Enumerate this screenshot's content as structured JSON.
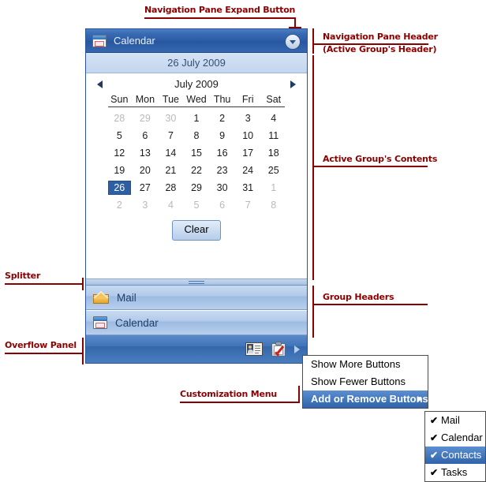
{
  "annotations": [
    {
      "key": "nav_expand",
      "text": "Navigation Pane Expand Button"
    },
    {
      "key": "nav_header",
      "text": "Navigation Pane Header"
    },
    {
      "key": "nav_header2",
      "text": "(Active Group's Header)"
    },
    {
      "key": "active_contents",
      "text": "Active Group's Contents"
    },
    {
      "key": "group_headers",
      "text": "Group Headers"
    },
    {
      "key": "splitter",
      "text": "Splitter"
    },
    {
      "key": "overflow",
      "text": "Overflow Panel"
    },
    {
      "key": "customization",
      "text": "Customization Menu"
    }
  ],
  "nav_pane": {
    "header": {
      "title": "Calendar",
      "icon": "calendar-icon",
      "expand_icon": "chevron-down-icon"
    },
    "date_banner": "26 July 2009",
    "month_nav": {
      "prev_icon": "prev-arrow-icon",
      "next_icon": "next-arrow-icon",
      "label": "July 2009"
    },
    "calendar": {
      "day_names": [
        "Sun",
        "Mon",
        "Tue",
        "Wed",
        "Thu",
        "Fri",
        "Sat"
      ],
      "weeks": [
        [
          {
            "d": "28",
            "out": true
          },
          {
            "d": "29",
            "out": true
          },
          {
            "d": "30",
            "out": true
          },
          {
            "d": "1"
          },
          {
            "d": "2"
          },
          {
            "d": "3"
          },
          {
            "d": "4"
          }
        ],
        [
          {
            "d": "5"
          },
          {
            "d": "6"
          },
          {
            "d": "7"
          },
          {
            "d": "8"
          },
          {
            "d": "9"
          },
          {
            "d": "10"
          },
          {
            "d": "11"
          }
        ],
        [
          {
            "d": "12"
          },
          {
            "d": "13"
          },
          {
            "d": "14"
          },
          {
            "d": "15"
          },
          {
            "d": "16"
          },
          {
            "d": "17"
          },
          {
            "d": "18"
          }
        ],
        [
          {
            "d": "19"
          },
          {
            "d": "20"
          },
          {
            "d": "21"
          },
          {
            "d": "22"
          },
          {
            "d": "23"
          },
          {
            "d": "24"
          },
          {
            "d": "25"
          }
        ],
        [
          {
            "d": "26",
            "selected": true
          },
          {
            "d": "27"
          },
          {
            "d": "28"
          },
          {
            "d": "29"
          },
          {
            "d": "30"
          },
          {
            "d": "31"
          },
          {
            "d": "1",
            "out": true
          }
        ],
        [
          {
            "d": "2",
            "out": true
          },
          {
            "d": "3",
            "out": true
          },
          {
            "d": "4",
            "out": true
          },
          {
            "d": "5",
            "out": true
          },
          {
            "d": "6",
            "out": true
          },
          {
            "d": "7",
            "out": true
          },
          {
            "d": "8",
            "out": true
          }
        ]
      ],
      "selected_day": "26"
    },
    "clear_button": "Clear",
    "splitter_icon": "splitter-grip-icon",
    "groups": [
      {
        "label": "Mail",
        "icon": "mail-icon"
      },
      {
        "label": "Calendar",
        "icon": "calendar-icon"
      }
    ],
    "overflow_panel": {
      "buttons": [
        {
          "name": "contacts-icon",
          "title": "Contacts"
        },
        {
          "name": "tasks-icon",
          "title": "Tasks"
        }
      ],
      "chevron_icon": "overflow-chevron-icon"
    }
  },
  "context_menu": {
    "items": [
      {
        "label": "Show More Buttons",
        "selected": false,
        "submenu": false
      },
      {
        "label": "Show Fewer Buttons",
        "selected": false,
        "submenu": false
      },
      {
        "label": "Add or Remove Buttons",
        "selected": true,
        "submenu": true
      }
    ]
  },
  "submenu": {
    "items": [
      {
        "label": "Mail",
        "checked": true,
        "highlighted": false
      },
      {
        "label": "Calendar",
        "checked": true,
        "highlighted": false
      },
      {
        "label": "Contacts",
        "checked": true,
        "highlighted": true
      },
      {
        "label": "Tasks",
        "checked": true,
        "highlighted": false
      }
    ],
    "check_glyph": "✔"
  },
  "colors": {
    "annotation": "#8b0000",
    "header_blue": "#2a5aa4",
    "selection_blue": "#2e5fa3",
    "group_header": "#b1c9e9"
  }
}
